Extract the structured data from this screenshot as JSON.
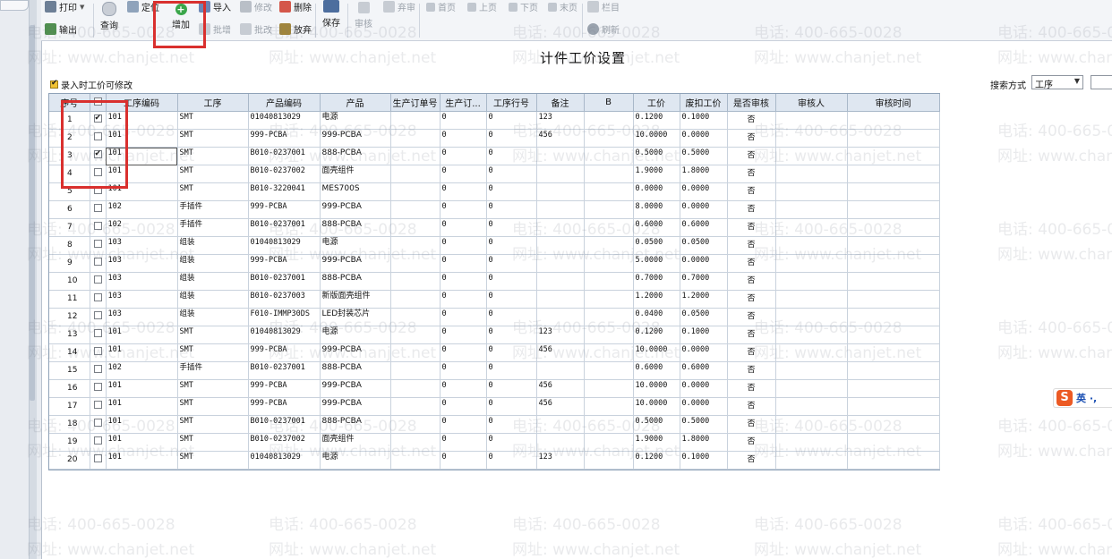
{
  "toolbar": {
    "print": "打印",
    "export": "输出",
    "query": "查询",
    "locate": "定位",
    "add": "增加",
    "import": "导入",
    "batch_add": "批增",
    "modify": "修改",
    "batch_modify": "批改",
    "delete": "删除",
    "discard": "放弃",
    "save": "保存",
    "approve": "审核",
    "unapprove": "弃审",
    "first": "首页",
    "prev": "上页",
    "next": "下页",
    "last": "末页",
    "columns": "栏目",
    "refresh": "刷新"
  },
  "page": {
    "title": "计件工价设置",
    "allow_edit_label": "录入时工价可修改",
    "search_label": "搜索方式",
    "search_value": "工序"
  },
  "table": {
    "headers": [
      "序号",
      "",
      "工序编码",
      "工序",
      "产品编码",
      "产品",
      "生产订单号",
      "生产订...",
      "工序行号",
      "备注",
      "B",
      "工价",
      "废扣工价",
      "是否审核",
      "审核人",
      "审核时间"
    ],
    "rows": [
      {
        "no": "1",
        "checked": true,
        "code": "101",
        "process": "SMT",
        "pcode": "01040813029",
        "product": "电源",
        "order": "",
        "orderline": "0",
        "procline": "0",
        "remark": "123",
        "b": "",
        "price": "0.1200",
        "deduct": "0.1000",
        "audited": "否",
        "auditor": "",
        "audit_time": ""
      },
      {
        "no": "2",
        "checked": false,
        "code": "101",
        "process": "SMT",
        "pcode": "999-PCBA",
        "product": "999-PCBA",
        "order": "",
        "orderline": "0",
        "procline": "0",
        "remark": "456",
        "b": "",
        "price": "10.0000",
        "deduct": "0.0000",
        "audited": "否",
        "auditor": "",
        "audit_time": ""
      },
      {
        "no": "3",
        "checked": true,
        "code": "101",
        "process": "SMT",
        "pcode": "B010-0237001",
        "product": "888-PCBA",
        "order": "",
        "orderline": "0",
        "procline": "0",
        "remark": "",
        "b": "",
        "price": "0.5000",
        "deduct": "0.5000",
        "audited": "否",
        "auditor": "",
        "audit_time": ""
      },
      {
        "no": "4",
        "checked": false,
        "code": "101",
        "process": "SMT",
        "pcode": "B010-0237002",
        "product": "面壳组件",
        "order": "",
        "orderline": "0",
        "procline": "0",
        "remark": "",
        "b": "",
        "price": "1.9000",
        "deduct": "1.8000",
        "audited": "否",
        "auditor": "",
        "audit_time": ""
      },
      {
        "no": "5",
        "checked": false,
        "code": "101",
        "process": "SMT",
        "pcode": "B010-3220041",
        "product": "MES700S",
        "order": "",
        "orderline": "0",
        "procline": "0",
        "remark": "",
        "b": "",
        "price": "0.0000",
        "deduct": "0.0000",
        "audited": "否",
        "auditor": "",
        "audit_time": ""
      },
      {
        "no": "6",
        "checked": false,
        "code": "102",
        "process": "手插件",
        "pcode": "999-PCBA",
        "product": "999-PCBA",
        "order": "",
        "orderline": "0",
        "procline": "0",
        "remark": "",
        "b": "",
        "price": "8.0000",
        "deduct": "0.0000",
        "audited": "否",
        "auditor": "",
        "audit_time": ""
      },
      {
        "no": "7",
        "checked": false,
        "code": "102",
        "process": "手插件",
        "pcode": "B010-0237001",
        "product": "888-PCBA",
        "order": "",
        "orderline": "0",
        "procline": "0",
        "remark": "",
        "b": "",
        "price": "0.6000",
        "deduct": "0.6000",
        "audited": "否",
        "auditor": "",
        "audit_time": ""
      },
      {
        "no": "8",
        "checked": false,
        "code": "103",
        "process": "组装",
        "pcode": "01040813029",
        "product": "电源",
        "order": "",
        "orderline": "0",
        "procline": "0",
        "remark": "",
        "b": "",
        "price": "0.0500",
        "deduct": "0.0500",
        "audited": "否",
        "auditor": "",
        "audit_time": ""
      },
      {
        "no": "9",
        "checked": false,
        "code": "103",
        "process": "组装",
        "pcode": "999-PCBA",
        "product": "999-PCBA",
        "order": "",
        "orderline": "0",
        "procline": "0",
        "remark": "",
        "b": "",
        "price": "5.0000",
        "deduct": "0.0000",
        "audited": "否",
        "auditor": "",
        "audit_time": ""
      },
      {
        "no": "10",
        "checked": false,
        "code": "103",
        "process": "组装",
        "pcode": "B010-0237001",
        "product": "888-PCBA",
        "order": "",
        "orderline": "0",
        "procline": "0",
        "remark": "",
        "b": "",
        "price": "0.7000",
        "deduct": "0.7000",
        "audited": "否",
        "auditor": "",
        "audit_time": ""
      },
      {
        "no": "11",
        "checked": false,
        "code": "103",
        "process": "组装",
        "pcode": "B010-0237003",
        "product": "新版面壳组件",
        "order": "",
        "orderline": "0",
        "procline": "0",
        "remark": "",
        "b": "",
        "price": "1.2000",
        "deduct": "1.2000",
        "audited": "否",
        "auditor": "",
        "audit_time": ""
      },
      {
        "no": "12",
        "checked": false,
        "code": "103",
        "process": "组装",
        "pcode": "F010-IMMP30DS",
        "product": "LED封装芯片",
        "order": "",
        "orderline": "0",
        "procline": "0",
        "remark": "",
        "b": "",
        "price": "0.0400",
        "deduct": "0.0500",
        "audited": "否",
        "auditor": "",
        "audit_time": ""
      },
      {
        "no": "13",
        "checked": false,
        "code": "101",
        "process": "SMT",
        "pcode": "01040813029",
        "product": "电源",
        "order": "",
        "orderline": "0",
        "procline": "0",
        "remark": "123",
        "b": "",
        "price": "0.1200",
        "deduct": "0.1000",
        "audited": "否",
        "auditor": "",
        "audit_time": ""
      },
      {
        "no": "14",
        "checked": false,
        "code": "101",
        "process": "SMT",
        "pcode": "999-PCBA",
        "product": "999-PCBA",
        "order": "",
        "orderline": "0",
        "procline": "0",
        "remark": "456",
        "b": "",
        "price": "10.0000",
        "deduct": "0.0000",
        "audited": "否",
        "auditor": "",
        "audit_time": ""
      },
      {
        "no": "15",
        "checked": false,
        "code": "102",
        "process": "手插件",
        "pcode": "B010-0237001",
        "product": "888-PCBA",
        "order": "",
        "orderline": "0",
        "procline": "0",
        "remark": "",
        "b": "",
        "price": "0.6000",
        "deduct": "0.6000",
        "audited": "否",
        "auditor": "",
        "audit_time": ""
      },
      {
        "no": "16",
        "checked": false,
        "code": "101",
        "process": "SMT",
        "pcode": "999-PCBA",
        "product": "999-PCBA",
        "order": "",
        "orderline": "0",
        "procline": "0",
        "remark": "456",
        "b": "",
        "price": "10.0000",
        "deduct": "0.0000",
        "audited": "否",
        "auditor": "",
        "audit_time": ""
      },
      {
        "no": "17",
        "checked": false,
        "code": "101",
        "process": "SMT",
        "pcode": "999-PCBA",
        "product": "999-PCBA",
        "order": "",
        "orderline": "0",
        "procline": "0",
        "remark": "456",
        "b": "",
        "price": "10.0000",
        "deduct": "0.0000",
        "audited": "否",
        "auditor": "",
        "audit_time": ""
      },
      {
        "no": "18",
        "checked": false,
        "code": "101",
        "process": "SMT",
        "pcode": "B010-0237001",
        "product": "888-PCBA",
        "order": "",
        "orderline": "0",
        "procline": "0",
        "remark": "",
        "b": "",
        "price": "0.5000",
        "deduct": "0.5000",
        "audited": "否",
        "auditor": "",
        "audit_time": ""
      },
      {
        "no": "19",
        "checked": false,
        "code": "101",
        "process": "SMT",
        "pcode": "B010-0237002",
        "product": "面壳组件",
        "order": "",
        "orderline": "0",
        "procline": "0",
        "remark": "",
        "b": "",
        "price": "1.9000",
        "deduct": "1.8000",
        "audited": "否",
        "auditor": "",
        "audit_time": ""
      },
      {
        "no": "20",
        "checked": false,
        "code": "101",
        "process": "SMT",
        "pcode": "01040813029",
        "product": "电源",
        "order": "",
        "orderline": "0",
        "procline": "0",
        "remark": "123",
        "b": "",
        "price": "0.1200",
        "deduct": "0.1000",
        "audited": "否",
        "auditor": "",
        "audit_time": ""
      }
    ]
  },
  "watermark": {
    "phone": "电话: 400-665-0028",
    "site": "网址: www.chanjet.net"
  },
  "ime": {
    "logo": "S",
    "mode": "英 ·,"
  }
}
